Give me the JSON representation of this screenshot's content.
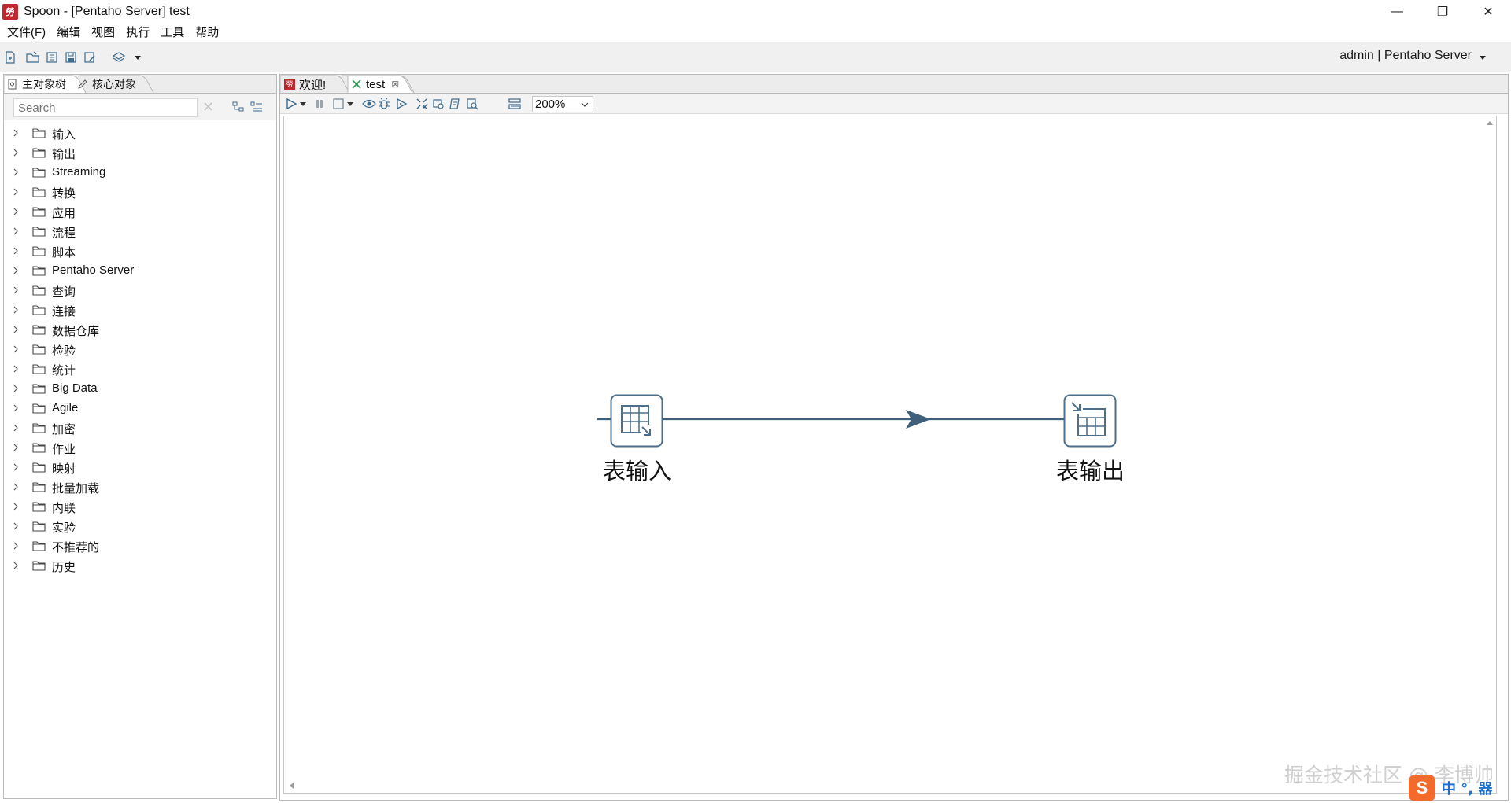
{
  "window": {
    "title": "Spoon - [Pentaho Server] test",
    "app_icon_text": "勞",
    "controls": {
      "minimize": "—",
      "restore": "❐",
      "close": "✕"
    }
  },
  "menu": [
    "文件(F)",
    "编辑",
    "视图",
    "执行",
    "工具",
    "帮助"
  ],
  "toolbar": {
    "icons": [
      "new-file-icon",
      "open-icon",
      "explore-repository-icon",
      "save-icon",
      "save-as-icon",
      "perspective-icon"
    ],
    "user": "admin  |  Pentaho Server"
  },
  "left_panel": {
    "tabs": [
      "主对象树",
      "核心对象"
    ],
    "search": {
      "placeholder": "Search",
      "clear": "✕"
    },
    "tree": [
      "输入",
      "输出",
      "Streaming",
      "转换",
      "应用",
      "流程",
      "脚本",
      "Pentaho Server",
      "查询",
      "连接",
      "数据仓库",
      "检验",
      "统计",
      "Big Data",
      "Agile",
      "加密",
      "作业",
      "映射",
      "批量加载",
      "内联",
      "实验",
      "不推荐的",
      "历史"
    ]
  },
  "right_panel": {
    "tabs": [
      "欢迎!",
      "test"
    ],
    "tab_close": "⊠",
    "zoom": "200%",
    "canvas_toolbar_icons": [
      "run-icon",
      "run-options-icon",
      "pause-icon",
      "stop-icon",
      "stop-options-icon",
      "preview-icon",
      "debug-icon",
      "replay-icon",
      "verify-icon",
      "impact-icon",
      "sql-icon",
      "explore-db-icon",
      "show-results-icon"
    ]
  },
  "canvas": {
    "steps": [
      {
        "id": "table-input",
        "label": "表输入"
      },
      {
        "id": "table-output",
        "label": "表输出"
      }
    ],
    "hops": [
      {
        "from": "table-input",
        "to": "table-output"
      }
    ],
    "colors": {
      "hop": "#3f5f7a",
      "step_border": "#4e6f8c"
    }
  },
  "watermark": "掘金技术社区 @ 李博帅",
  "ime": {
    "logo": "S",
    "text": "中 °, 器"
  }
}
